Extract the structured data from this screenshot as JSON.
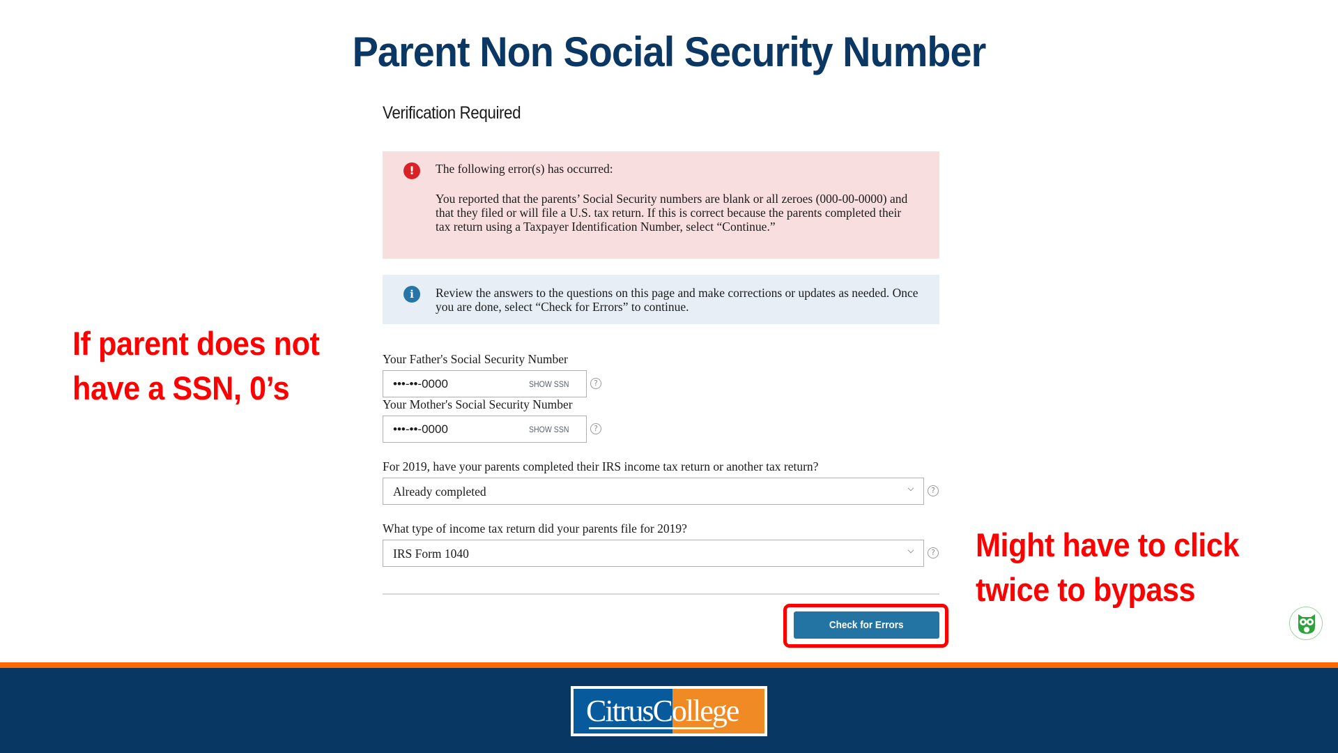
{
  "slide": {
    "title": "Parent Non Social Security Number",
    "annotation_left": [
      "If parent does not",
      "have a SSN, 0’s"
    ],
    "annotation_right": [
      "Might have to click",
      "twice to bypass"
    ]
  },
  "page": {
    "heading": "Verification Required"
  },
  "error_alert": {
    "icon": "exclamation-circle-icon",
    "heading": "The following error(s) has occurred:",
    "body": "You reported that the parents’ Social Security numbers are blank or all zeroes (000-00-0000) and that they filed or will file a U.S. tax return. If this is correct because the parents completed their tax return using a Taxpayer Identification Number, select “Continue.”",
    "color": "#d72228"
  },
  "info_alert": {
    "icon": "info-circle-icon",
    "body": "Review the answers to the questions on this page and make corrections or updates as needed. Once you are done, select “Check for Errors” to continue.",
    "color": "#2774a8"
  },
  "fields": {
    "father_ssn": {
      "label": "Your Father's Social Security Number",
      "value": "•••-••-0000",
      "toggle_label": "SHOW SSN",
      "help": "?"
    },
    "mother_ssn": {
      "label": "Your Mother's Social Security Number",
      "value": "•••-••-0000",
      "toggle_label": "SHOW SSN",
      "help": "?"
    },
    "tax_return_status": {
      "label": "For 2019, have your parents completed their IRS income tax return or another tax return?",
      "selected": "Already completed",
      "help": "?"
    },
    "tax_return_type": {
      "label": "What type of income tax return did your parents file for 2019?",
      "selected": "IRS Form 1040",
      "help": "?"
    }
  },
  "actions": {
    "check_errors_label": "Check for Errors",
    "button_color": "#2374a2"
  },
  "footer": {
    "logo_word1": "Citrus",
    "logo_word2": "College",
    "stripe_color": "#ff6a00",
    "bg_color": "#093764"
  }
}
